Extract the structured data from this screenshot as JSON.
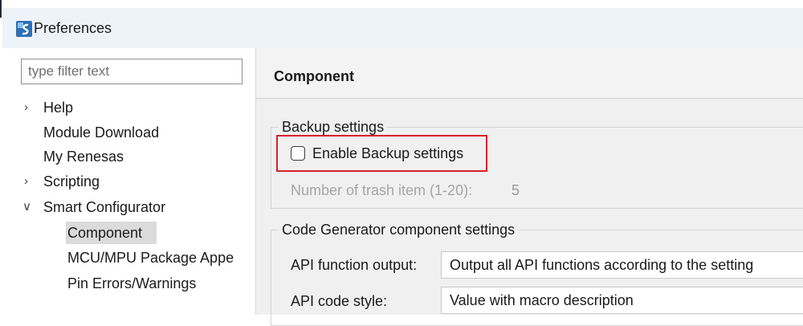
{
  "window": {
    "title": "Preferences",
    "icon": "renesas-app-icon"
  },
  "filter": {
    "placeholder": "type filter text",
    "value": ""
  },
  "tree": [
    {
      "label": "Help",
      "expander": ">"
    },
    {
      "label": "Module Download",
      "expander": ""
    },
    {
      "label": "My Renesas",
      "expander": ""
    },
    {
      "label": "Scripting",
      "expander": ">"
    },
    {
      "label": "Smart Configurator",
      "expander": "v"
    },
    {
      "label": "Component",
      "expander": "",
      "selected": true
    },
    {
      "label": "MCU/MPU Package Appe",
      "expander": ""
    },
    {
      "label": "Pin Errors/Warnings",
      "expander": ""
    }
  ],
  "page": {
    "title": "Component",
    "backup": {
      "group_title": "Backup settings",
      "enable_label": "Enable Backup settings",
      "enable_checked": false,
      "trash_label": "Number of trash item (1-20):",
      "trash_value": "5"
    },
    "codegen": {
      "group_title": "Code Generator component settings",
      "api_output_label": "API function output:",
      "api_output_value": "Output all API functions according to the setting",
      "api_style_label": "API code style:",
      "api_style_value": "Value with macro description"
    }
  },
  "colors": {
    "highlight": "#d9202b",
    "selection": "#dbdbdb",
    "title_bar": "#eef3f9"
  }
}
